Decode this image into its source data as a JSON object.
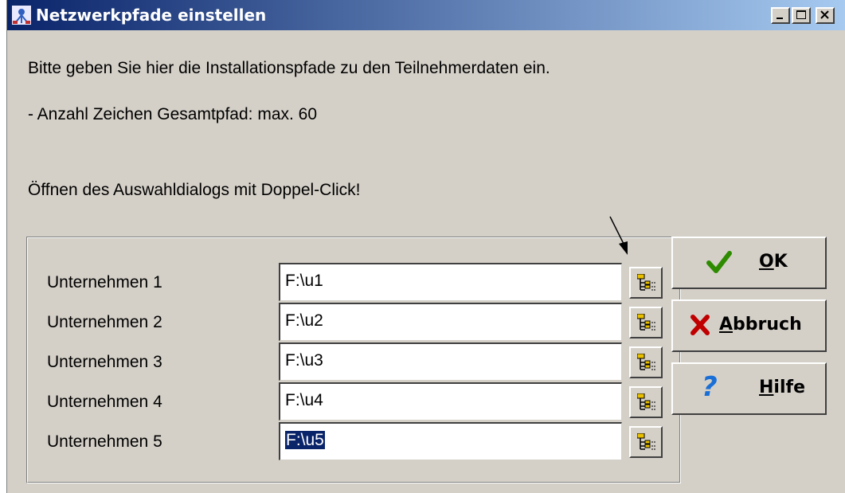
{
  "window": {
    "title": "Netzwerkpfade einstellen",
    "icons": {
      "app": "network-app-icon",
      "minimize": "minimize-icon",
      "maximize": "maximize-icon",
      "close": "close-icon"
    }
  },
  "messages": {
    "line1": "Bitte geben Sie hier die Installationspfade zu den Teilnehmerdaten ein.",
    "line2": "- Anzahl Zeichen Gesamtpfad: max. 60",
    "line3": "Öffnen des Auswahldialogs mit Doppel-Click!"
  },
  "rows": [
    {
      "label": "Unternehmen 1",
      "value": "F:\\u1",
      "selected": false
    },
    {
      "label": "Unternehmen 2",
      "value": "F:\\u2",
      "selected": false
    },
    {
      "label": "Unternehmen 3",
      "value": "F:\\u3",
      "selected": false
    },
    {
      "label": "Unternehmen 4",
      "value": "F:\\u4",
      "selected": false
    },
    {
      "label": "Unternehmen 5",
      "value": "F:\\u5",
      "selected": true
    }
  ],
  "buttons": {
    "ok": {
      "mnemonic": "O",
      "rest": "K",
      "icon": "checkmark-icon",
      "color": "#2e8b00"
    },
    "cancel": {
      "mnemonic": "A",
      "rest": "bbruch",
      "icon": "x-icon",
      "color": "#c00000"
    },
    "help": {
      "mnemonic": "H",
      "rest": "ilfe",
      "icon": "question-icon",
      "color": "#1a6fd6"
    }
  },
  "annotation": {
    "icon": "pointer-arrow-icon"
  },
  "colors": {
    "titlebar_start": "#0a246a",
    "titlebar_end": "#a6caf0",
    "dialog_bg": "#d4d0c8",
    "selection": "#0a246a"
  }
}
